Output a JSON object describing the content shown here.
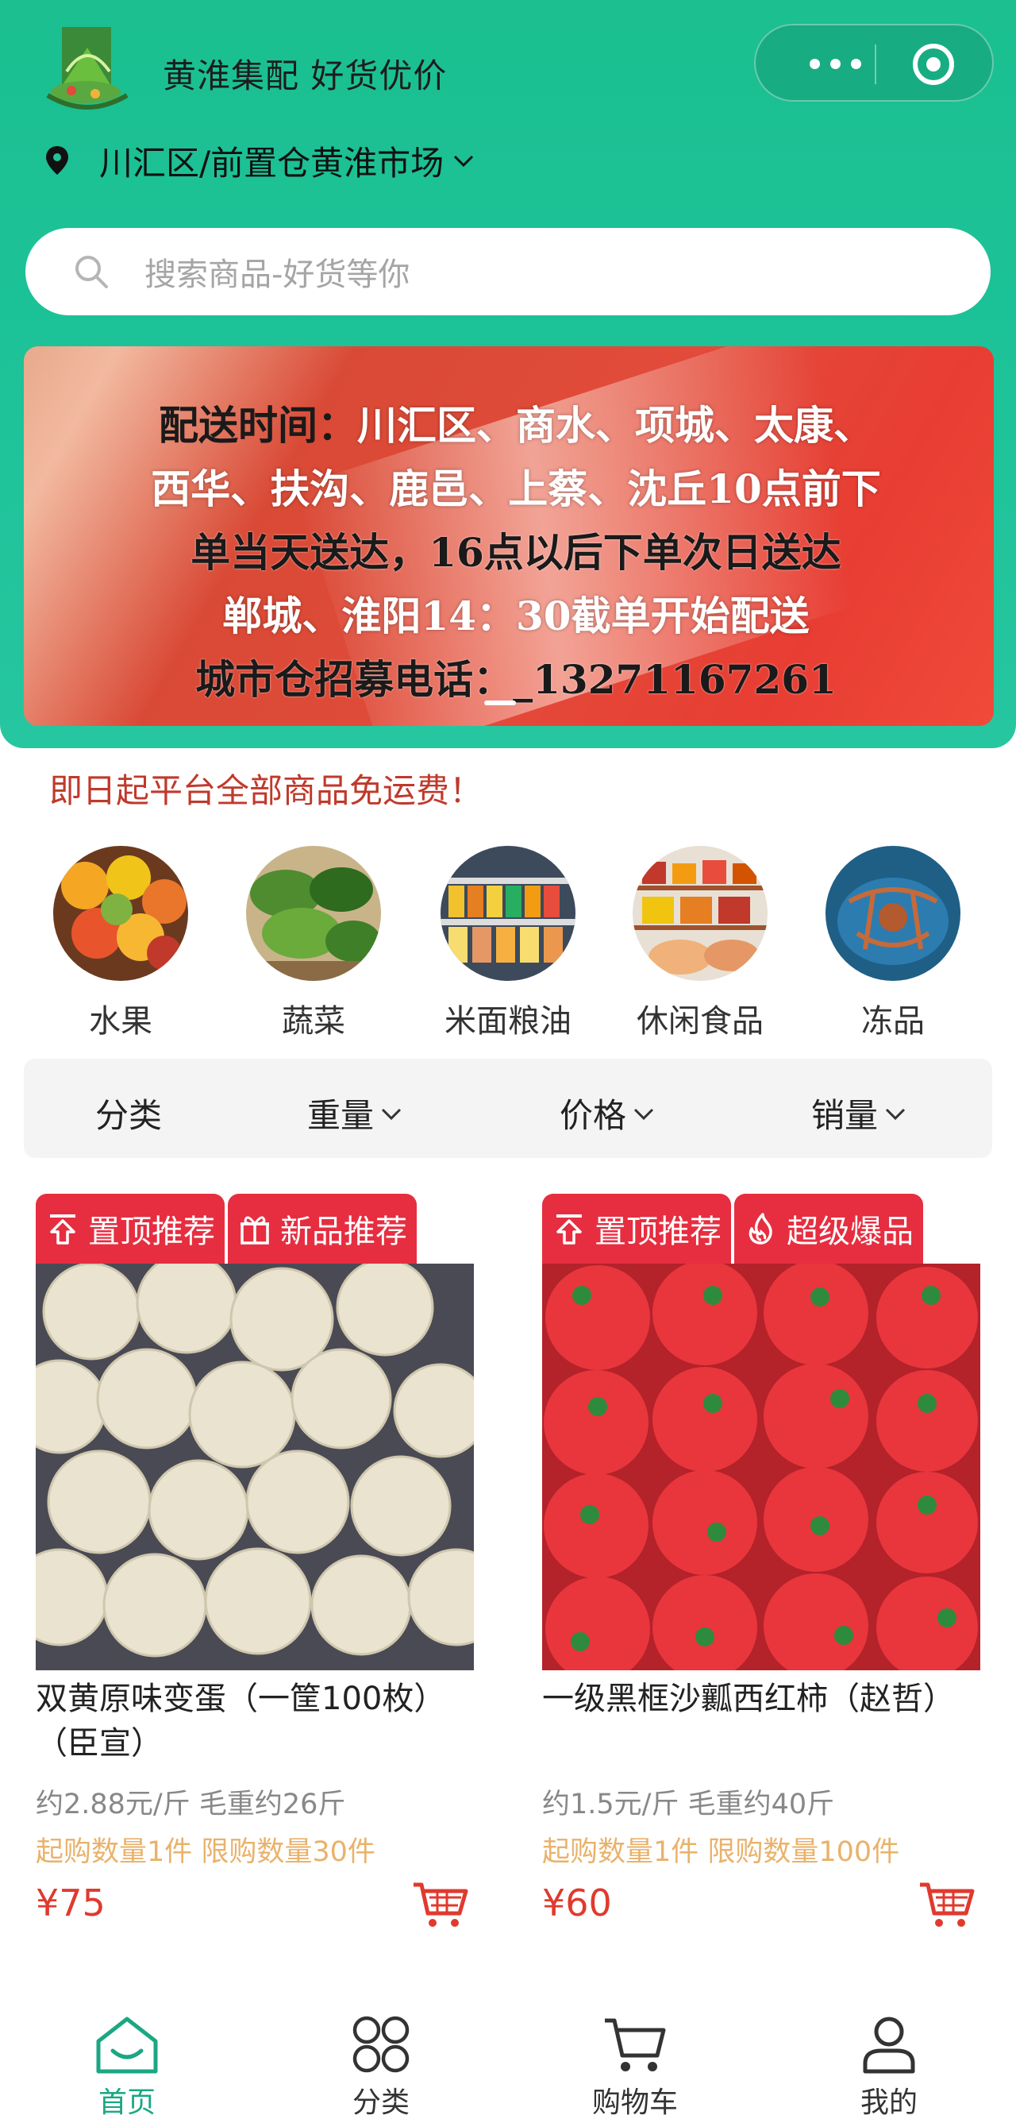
{
  "header": {
    "app_title": "黄淮集配 好货优价",
    "location": "川汇区/前置仓黄淮市场"
  },
  "search": {
    "placeholder": "搜索商品-好货等你"
  },
  "banner": {
    "lines": [
      "配送时间：川汇区、商水、项城、太康、",
      "西华、扶沟、鹿邑、上蔡、沈丘10点前下",
      "单当天送达，16点以后下单次日送达",
      "郸城、淮阳14：30截单开始配送",
      "城市仓招募电话：_13271167261"
    ],
    "lead": "配送时间：",
    "line1_rest": "川汇区、商水、项城、太康、"
  },
  "notice": "即日起平台全部商品免运费！",
  "categories": [
    {
      "label": "水果",
      "icon": "fruit-photo"
    },
    {
      "label": "蔬菜",
      "icon": "vegetable-photo"
    },
    {
      "label": "米面粮油",
      "icon": "grain-oil-photo"
    },
    {
      "label": "休闲食品",
      "icon": "snack-photo"
    },
    {
      "label": "冻品",
      "icon": "frozen-photo"
    }
  ],
  "filters": [
    {
      "label": "分类",
      "has_arrow": false
    },
    {
      "label": "重量",
      "has_arrow": true
    },
    {
      "label": "价格",
      "has_arrow": true
    },
    {
      "label": "销量",
      "has_arrow": true
    }
  ],
  "products": [
    {
      "tags": [
        "置顶推荐",
        "新品推荐"
      ],
      "name": "双黄原味变蛋（一筐100枚）（臣宣）",
      "meta": "约2.88元/斤 毛重约26斤",
      "limit": "起购数量1件 限购数量30件",
      "price": "¥75"
    },
    {
      "tags": [
        "置顶推荐",
        "超级爆品"
      ],
      "name": "一级黑框沙瓤西红柿（赵哲）",
      "meta": "约1.5元/斤 毛重约40斤",
      "limit": "起购数量1件 限购数量100件",
      "price": "¥60"
    }
  ],
  "tabbar": {
    "items": [
      {
        "label": "首页",
        "icon": "home-icon",
        "active": true
      },
      {
        "label": "分类",
        "icon": "category-icon",
        "active": false
      },
      {
        "label": "购物车",
        "icon": "cart-icon",
        "active": false
      },
      {
        "label": "我的",
        "icon": "profile-icon",
        "active": false
      }
    ]
  },
  "colors": {
    "brand_green": "#1bbf90",
    "tag_red": "#e62e40",
    "price_red": "#e03a2e",
    "limit_orange": "#e9b26b",
    "tab_active": "#1aa784"
  }
}
